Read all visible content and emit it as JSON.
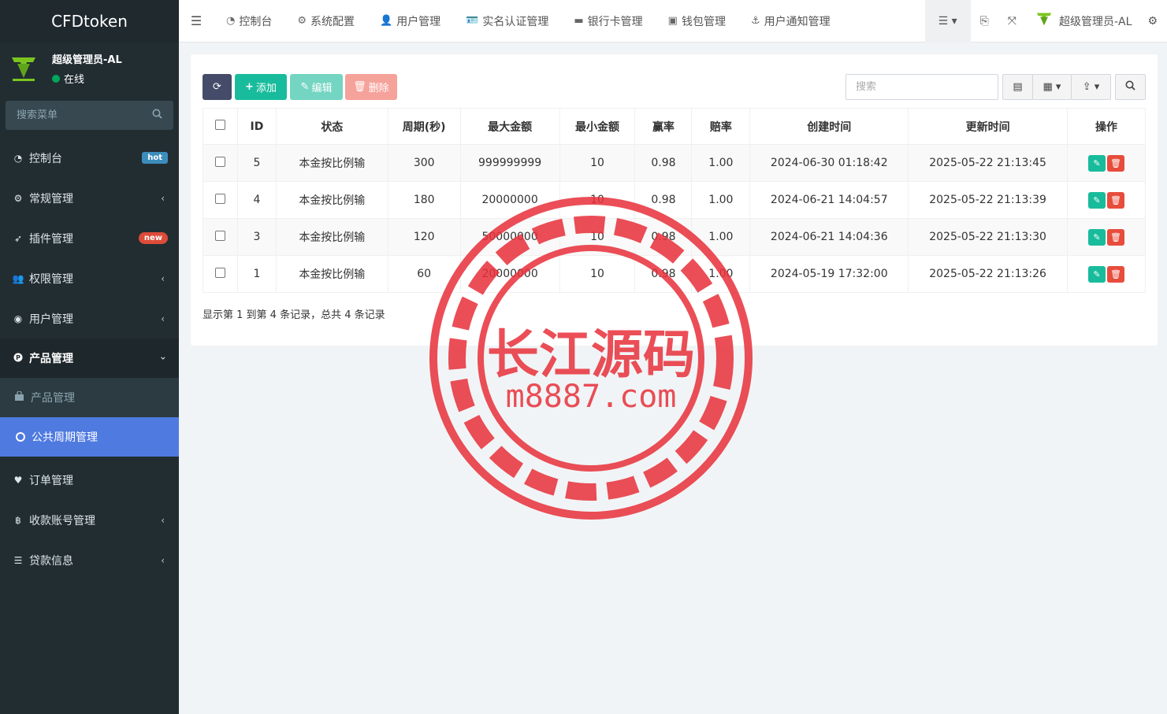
{
  "brand": "CFDtoken",
  "user": {
    "name": "超级管理员-AL",
    "status": "在线"
  },
  "sidebar": {
    "search_placeholder": "搜索菜单",
    "items": [
      {
        "label": "控制台",
        "icon": "dashboard-icon",
        "badge": "hot"
      },
      {
        "label": "常规管理",
        "icon": "cogs-icon"
      },
      {
        "label": "插件管理",
        "icon": "rocket-icon",
        "badge": "new"
      },
      {
        "label": "权限管理",
        "icon": "group-icon"
      },
      {
        "label": "用户管理",
        "icon": "user-circle-icon"
      },
      {
        "label": "产品管理",
        "icon": "product-icon"
      },
      {
        "label": "订单管理",
        "icon": "heartbeat-icon"
      },
      {
        "label": "收款账号管理",
        "icon": "bitcoin-icon"
      },
      {
        "label": "贷款信息",
        "icon": "list-icon"
      }
    ],
    "sub_items": [
      {
        "label": "产品管理",
        "icon": "shopping-bag-icon"
      },
      {
        "label": "公共周期管理",
        "icon": "circle-icon"
      }
    ]
  },
  "topnav": {
    "tabs": [
      {
        "label": "控制台",
        "icon": "dashboard-icon"
      },
      {
        "label": "系统配置",
        "icon": "gear-icon"
      },
      {
        "label": "用户管理",
        "icon": "user-icon"
      },
      {
        "label": "实名认证管理",
        "icon": "id-card-icon"
      },
      {
        "label": "银行卡管理",
        "icon": "credit-card-icon"
      },
      {
        "label": "钱包管理",
        "icon": "wallet-icon"
      },
      {
        "label": "用户通知管理",
        "icon": "anchor-icon"
      }
    ],
    "admin_name": "超级管理员-AL"
  },
  "toolbar": {
    "add_label": "添加",
    "edit_label": "编辑",
    "delete_label": "删除",
    "search_placeholder": "搜索"
  },
  "table": {
    "headers": [
      "ID",
      "状态",
      "周期(秒)",
      "最大金额",
      "最小金额",
      "赢率",
      "赔率",
      "创建时间",
      "更新时间",
      "操作"
    ],
    "rows": [
      {
        "id": "5",
        "status": "本金按比例输",
        "period": "300",
        "max": "999999999",
        "min": "10",
        "win": "0.98",
        "odds": "1.00",
        "created": "2024-06-30 01:18:42",
        "updated": "2025-05-22 21:13:45"
      },
      {
        "id": "4",
        "status": "本金按比例输",
        "period": "180",
        "max": "20000000",
        "min": "10",
        "win": "0.98",
        "odds": "1.00",
        "created": "2024-06-21 14:04:57",
        "updated": "2025-05-22 21:13:39"
      },
      {
        "id": "3",
        "status": "本金按比例输",
        "period": "120",
        "max": "50000000",
        "min": "10",
        "win": "0.98",
        "odds": "1.00",
        "created": "2024-06-21 14:04:36",
        "updated": "2025-05-22 21:13:30"
      },
      {
        "id": "1",
        "status": "本金按比例输",
        "period": "60",
        "max": "20000000",
        "min": "10",
        "win": "0.98",
        "odds": "1.00",
        "created": "2024-05-19 17:32:00",
        "updated": "2025-05-22 21:13:26"
      }
    ]
  },
  "pager_text": "显示第 1 到第 4 条记录，总共 4 条记录",
  "watermark": {
    "title": "长江源码",
    "url": "m8887.com"
  },
  "colors": {
    "sidebar_bg": "#222d32",
    "active": "#4f7ae0",
    "add": "#18bc9c",
    "delete": "#e74c3c",
    "stamp": "#e8303a"
  }
}
